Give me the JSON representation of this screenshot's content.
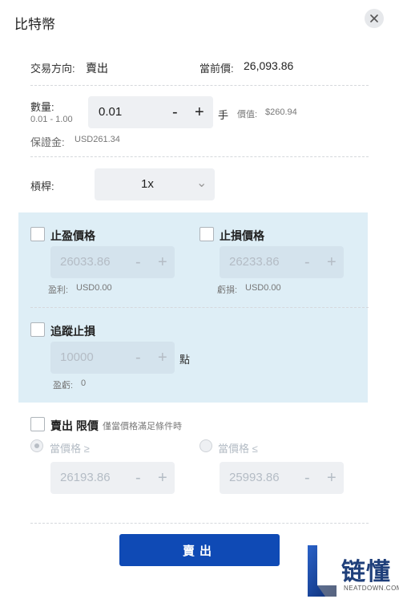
{
  "header": {
    "title": "比特幣"
  },
  "summary": {
    "direction_label": "交易方向:",
    "direction_value": "賣出",
    "price_label": "當前價:",
    "price_value": "26,093.86"
  },
  "volume": {
    "label": "數量:",
    "range": "0.01 - 1.00",
    "value": "0.01",
    "unit": "手",
    "worth_label": "價值:",
    "worth_value": "$260.94",
    "margin_label": "保證金:",
    "margin_value": "USD261.34"
  },
  "leverage": {
    "label": "槓桿:",
    "value": "1x"
  },
  "take_profit": {
    "label": "止盈價格",
    "value": "26033.86",
    "footer_label": "盈利:",
    "footer_value": "USD0.00"
  },
  "stop_loss": {
    "label": "止損價格",
    "value": "26233.86",
    "footer_label": "虧損:",
    "footer_value": "USD0.00"
  },
  "trailing": {
    "label": "追蹤止損",
    "value": "10000",
    "unit": "點",
    "footer_label": "盈虧:",
    "footer_value": "0"
  },
  "limit": {
    "label_main": "賣出 限價",
    "label_sub": "僅當價格滿足條件時",
    "option_ge": "當價格 ≥",
    "option_le": "當價格 ≤",
    "value_ge": "26193.86",
    "value_le": "25993.86"
  },
  "controls": {
    "minus": "-",
    "plus": "+",
    "chevron": "⌄"
  },
  "submit": {
    "label": "賣出"
  },
  "watermark": {
    "name": "链懂",
    "domain": "NEATDOWN.COM"
  },
  "colors": {
    "accent": "#0f4ab5",
    "highlight_bg": "#deeef6",
    "field_bg": "#eef0f3"
  }
}
